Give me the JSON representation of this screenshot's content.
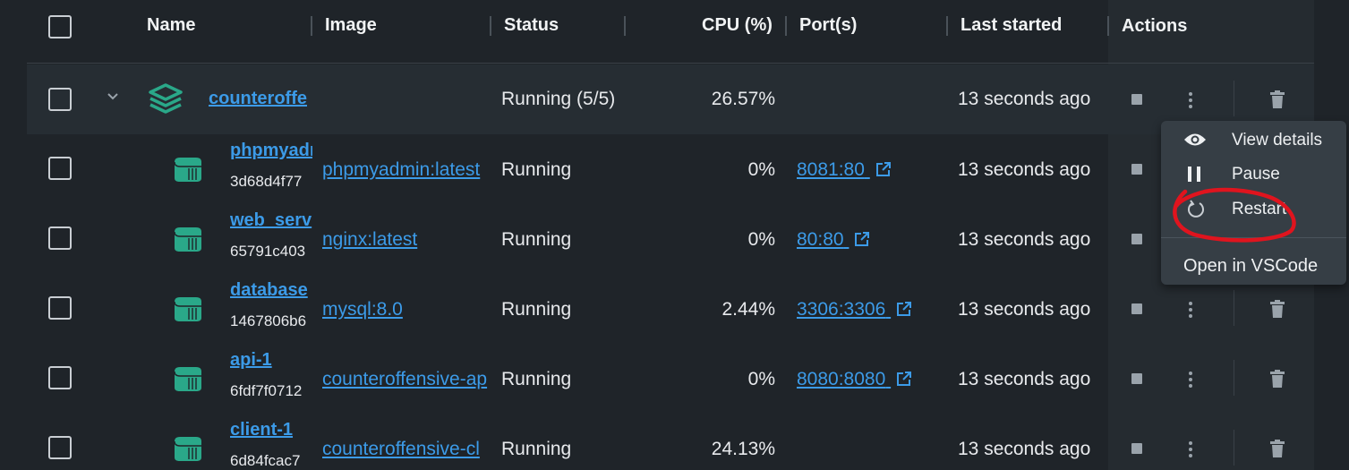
{
  "header": {
    "name": "Name",
    "image": "Image",
    "status": "Status",
    "cpu": "CPU (%)",
    "ports": "Port(s)",
    "last_started": "Last started",
    "actions": "Actions"
  },
  "group": {
    "name": "counteroffe",
    "status": "Running (5/5)",
    "cpu": "26.57%",
    "last_started": "13 seconds ago",
    "icon": "stack-layers-icon"
  },
  "containers": [
    {
      "name": "phpmyadr",
      "id": "3d68d4f77",
      "image": "phpmyadmin:latest",
      "status": "Running",
      "cpu": "0%",
      "port": "8081:80",
      "last_started": "13 seconds ago"
    },
    {
      "name": "web_serv",
      "id": "65791c403",
      "image": "nginx:latest",
      "status": "Running",
      "cpu": "0%",
      "port": "80:80",
      "last_started": "13 seconds ago"
    },
    {
      "name": "database",
      "id": "1467806b6",
      "image": "mysql:8.0",
      "status": "Running",
      "cpu": "2.44%",
      "port": "3306:3306",
      "last_started": "13 seconds ago"
    },
    {
      "name": "api-1",
      "id": "6fdf7f0712",
      "image": "counteroffensive-ap",
      "status": "Running",
      "cpu": "0%",
      "port": "8080:8080",
      "last_started": "13 seconds ago"
    },
    {
      "name": "client-1",
      "id": "6d84fcac7",
      "image": "counteroffensive-cl",
      "status": "Running",
      "cpu": "24.13%",
      "port": "",
      "last_started": "13 seconds ago"
    }
  ],
  "context_menu": {
    "items": [
      {
        "label": "View details",
        "icon": "eye-icon"
      },
      {
        "label": "Pause",
        "icon": "pause-icon"
      },
      {
        "label": "Restart",
        "icon": "restart-icon"
      },
      {
        "label": "Open in VSCode",
        "icon": ""
      }
    ]
  },
  "colors": {
    "background": "#1f2429",
    "accent_link": "#3c9be8",
    "container_icon": "#2aa889",
    "annotation": "#e0141e"
  }
}
